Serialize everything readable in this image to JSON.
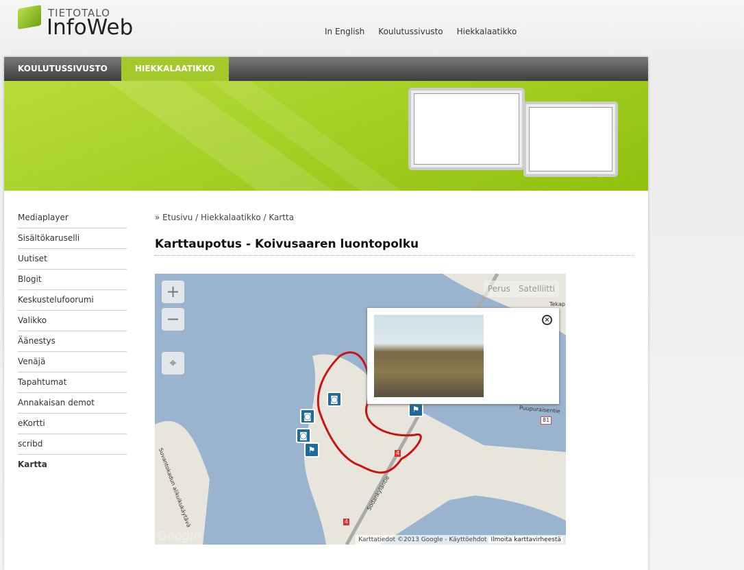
{
  "logo": {
    "brand": "TIETOTALO",
    "product": "InfoWeb"
  },
  "toplinks": [
    "In English",
    "Koulutussivusto",
    "Hiekkalaatikko"
  ],
  "tabs": [
    {
      "label": "KOULUTUSSIVUSTO",
      "active": false
    },
    {
      "label": "HIEKKALAATIKKO",
      "active": true
    }
  ],
  "sidebar": [
    "Mediaplayer",
    "Sisältökaruselli",
    "Uutiset",
    "Blogit",
    "Keskustelufoorumi",
    "Valikko",
    "Äänestys",
    "Venäjä",
    "Tapahtumat",
    "Annakaisan demot",
    "eKortti",
    "scribd",
    "Kartta"
  ],
  "breadcrumb": "» Etusivu / Hiekkalaatikko / Kartta",
  "title": "Karttaupotus - Koivusaaren luontopolku",
  "map": {
    "zoom_in": "+",
    "zoom_out": "−",
    "types": [
      "Perus",
      "Satelliitti"
    ],
    "attribution": "Karttatiedot ©2013 Google - Käyttöehdot",
    "report": "Ilmoita karttavirheestä",
    "google": "Google",
    "route_color": "#cc1111",
    "road_labels": [
      "Sodankyläntie",
      "Suvantokadun alikulkukäytävä",
      "4",
      "81",
      "Tekap",
      "Puupuraisentie"
    ]
  }
}
